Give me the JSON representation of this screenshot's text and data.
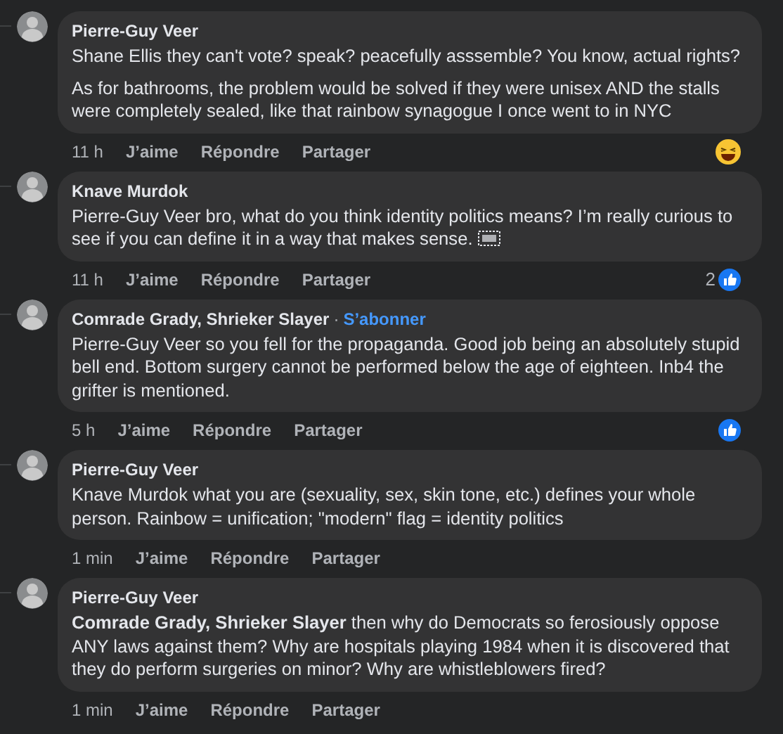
{
  "comments": [
    {
      "author": "Pierre-Guy Veer",
      "paragraphs": [
        "Shane Ellis they can't vote? speak? peacefully asssemble? You know, actual rights?",
        "As for bathrooms, the problem would be solved if they were unisex AND the stalls were completely sealed, like that rainbow synagogue I once went to in NYC"
      ],
      "time": "11 h",
      "actions": [
        "J’aime",
        "Répondre",
        "Partager"
      ],
      "reaction": {
        "kind": "haha"
      }
    },
    {
      "author": "Knave Murdok",
      "paragraphs": [
        "Pierre-Guy Veer bro, what do you think identity politics means? I’m really curious to see if you can define it in a way that makes sense."
      ],
      "object_placeholder": true,
      "time": "11 h",
      "actions": [
        "J’aime",
        "Répondre",
        "Partager"
      ],
      "reaction": {
        "kind": "like",
        "count": "2"
      }
    },
    {
      "author": "Comrade Grady, Shrieker Slayer",
      "separator": "·",
      "follow": "S’abonner",
      "paragraphs": [
        "Pierre-Guy Veer so you fell for the propaganda. Good job being an absolutely stupid bell end. Bottom surgery cannot be performed below the age of eighteen. Inb4 the grifter is mentioned."
      ],
      "time": "5 h",
      "actions": [
        "J’aime",
        "Répondre",
        "Partager"
      ],
      "reaction": {
        "kind": "like"
      }
    },
    {
      "author": "Pierre-Guy Veer",
      "paragraphs": [
        "Knave Murdok what you are (sexuality, sex, skin tone, etc.) defines your whole person. Rainbow = unification; \"modern\" flag = identity politics"
      ],
      "time": "1 min",
      "actions": [
        "J’aime",
        "Répondre",
        "Partager"
      ]
    },
    {
      "author": "Pierre-Guy Veer",
      "paragraphs": [
        "**Comrade Grady, Shrieker Slayer** then why do Democrats so ferosiously oppose ANY laws against them? Why are hospitals playing 1984 when it is discovered that they do perform surgeries on minor? Why are whistleblowers fired?"
      ],
      "time": "1 min",
      "actions": [
        "J’aime",
        "Répondre",
        "Partager"
      ]
    }
  ]
}
